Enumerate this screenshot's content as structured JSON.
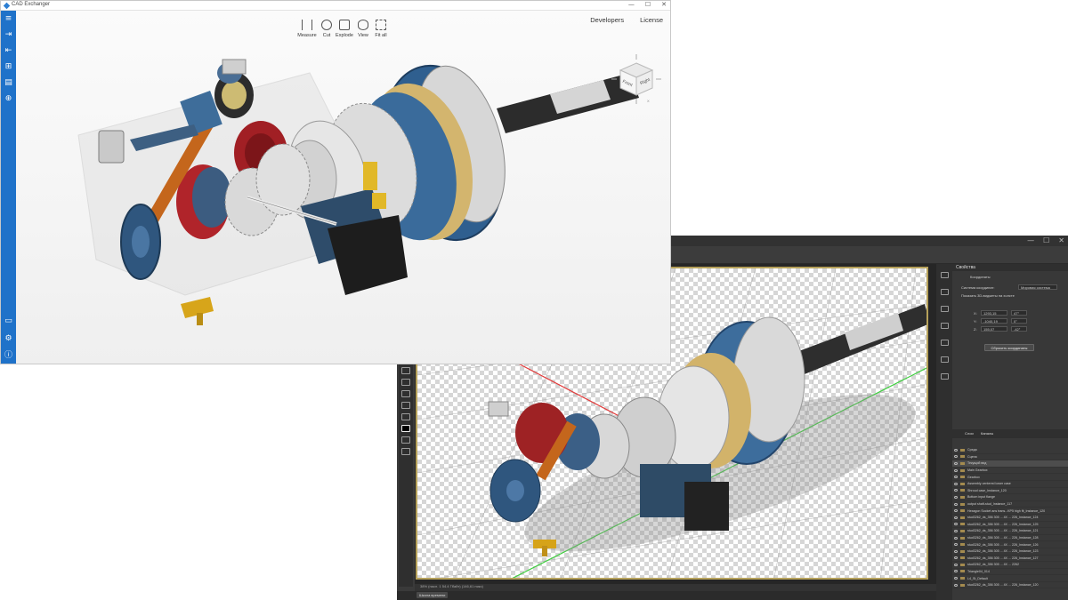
{
  "cad_window": {
    "title": "CAD Exchanger",
    "window_controls": {
      "minimize": "—",
      "maximize": "☐",
      "close": "✕"
    },
    "sidebar_icons": [
      "menu-icon",
      "import-icon",
      "export-icon",
      "structure-icon",
      "file-icon",
      "web-icon",
      "chat-icon",
      "settings-icon",
      "info-icon"
    ],
    "toolbar": {
      "measure": "Measure",
      "cut": "Cut",
      "explode": "Explode",
      "view": "View",
      "fit_all": "Fit all"
    },
    "links": {
      "developers": "Developers",
      "license": "License"
    },
    "view_cube": {
      "front": "Front",
      "right": "Right",
      "axis_x": "X",
      "axis_y": "Y",
      "axis_z": "Z"
    },
    "accent_color": "#1f72c9"
  },
  "photoshop_window": {
    "window_controls": {
      "minimize": "—",
      "maximize": "☐",
      "close": "✕"
    },
    "properties_panel": {
      "title": "Свойства",
      "section": "Координаты",
      "coord_system_label": "Система координат:",
      "coord_system_value": "Мировая система",
      "axis_label": "Показать 3D-виджеты на холсте",
      "x_label": "X:",
      "x_value": "1293,15",
      "x_rot": "47°",
      "y_label": "Y:",
      "y_value": "-1040,19",
      "y_rot": "0°",
      "z_label": "Z:",
      "z_value": "155,07",
      "z_rot": "-42°",
      "reset_button": "Сбросить координаты"
    },
    "layers_tabs": [
      "Слои",
      "Каналы"
    ],
    "layers": [
      "Среда",
      "Сцена",
      "Текущий вид",
      "Main Gearbox",
      "Gearbox",
      "Assembly centered lower case",
      "Shroud case_Instance_120",
      "Bottom input flange",
      "output shaft-stud_Instance_117",
      "Hexagon Socket ans trans...KP5 high fit_Instance_120",
      "stud3262_ds_356 305 ... 4X ... 226_Instance_124",
      "stud3262_ds_356 305 ... 4X ... 226_Instance_125",
      "stud3262_ds_356 305 ... 4X ... 226_Instance_121",
      "stud3262_ds_356 305 ... 4X ... 226_Instance_128",
      "stud3262_ds_356 305 ... 4X ... 226_Instance_126",
      "stud3262_ds_356 305 ... 4X ... 226_Instance_123",
      "stud3262_ds_356 305 ... 4X ... 226_Instance_127",
      "stud3262_ds_356 305 ... 4X ... 2262",
      "Triangle04_014",
      "L4_St_Default",
      "stud3262_ds_356 305 ... 4X ... 226_Instance_120"
    ],
    "selected_layer_index": 2,
    "status": "38% (пасл. 1 54.4 Гбайт) (146,61 пикс)",
    "timeline_button": "Шкала времени",
    "canvas_border_color": "#b6a15a"
  }
}
